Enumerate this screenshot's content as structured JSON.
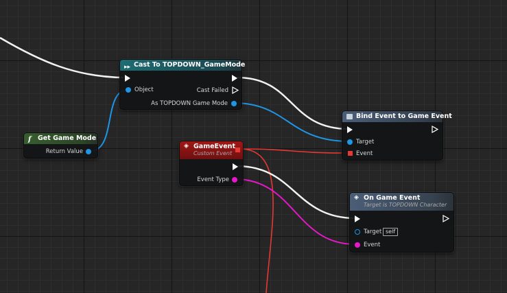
{
  "colors": {
    "exec": "#ffffff",
    "object_pin": "#1f95e6",
    "event_pin": "#e619c8",
    "delegate_pin": "#e53935",
    "cast_header": "#1c6d73",
    "pure_header": "#375e2e",
    "event_header": "#8f1414",
    "function_header": "#4b5e78"
  },
  "nodes": {
    "cast": {
      "title": "Cast To TOPDOWN_GameMode",
      "icon": "cast-arrows-icon",
      "pins": {
        "object": "Object",
        "cast_failed": "Cast Failed",
        "as_game_mode": "As TOPDOWN Game Mode"
      }
    },
    "get_game_mode": {
      "title": "Get Game Mode",
      "icon": "function-icon",
      "pins": {
        "return_value": "Return Value"
      }
    },
    "game_event": {
      "title": "GameEvent",
      "subtitle": "Custom Event",
      "icon": "event-diamond-icon",
      "pins": {
        "event_type": "Event Type"
      }
    },
    "bind_event": {
      "title": "Bind Event to Game Event",
      "icon": "function-box-icon",
      "pins": {
        "target": "Target",
        "event": "Event"
      }
    },
    "on_game_event": {
      "title": "On Game Event",
      "subtitle": "Target is TOPDOWN Character",
      "icon": "event-diamond-icon",
      "pins": {
        "target": "Target",
        "target_default": "self",
        "event": "Event"
      }
    }
  }
}
